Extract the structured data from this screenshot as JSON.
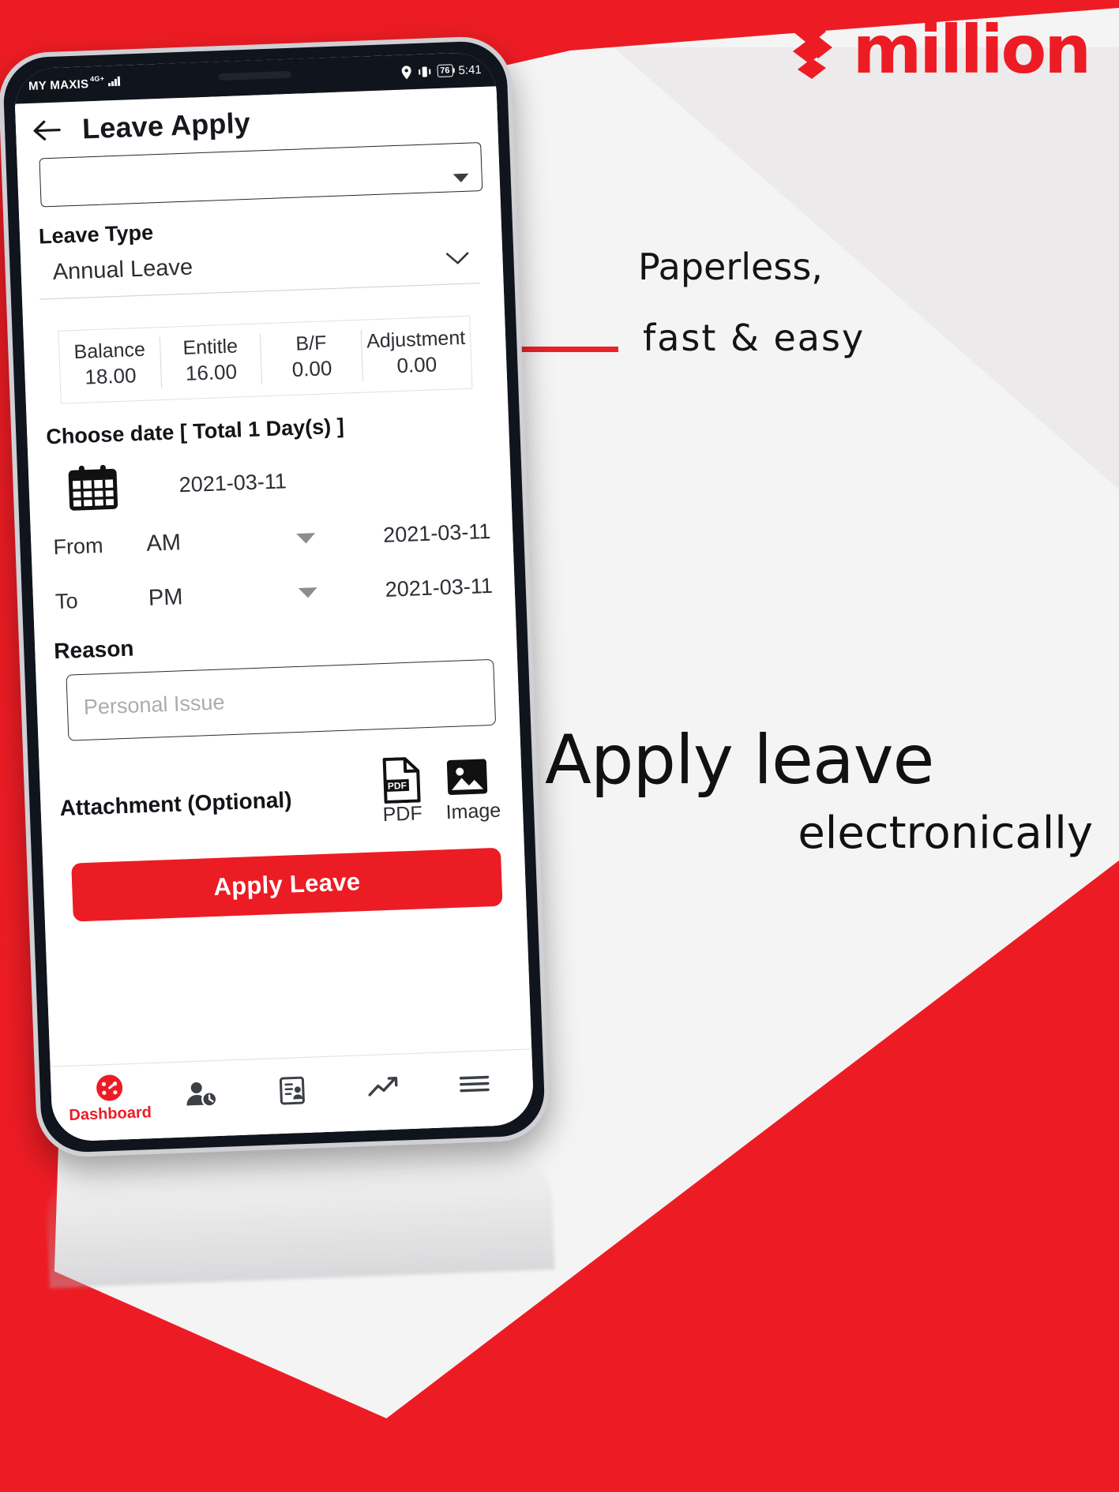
{
  "brand": {
    "logo_word": "million",
    "logo_mark": "million-logo-mark",
    "accent_color": "#ed1c24"
  },
  "marketing": {
    "tagline_line1": "Paperless,",
    "tagline_line2": "fast  &  easy",
    "headline": "Apply leave",
    "subhead": "electronically"
  },
  "phone": {
    "statusbar": {
      "carrier": "MY MAXIS",
      "network": "4G+",
      "signal_icon": "signal-bars-icon",
      "location_icon": "location-pin-icon",
      "vibrate_icon": "vibrate-icon",
      "battery_level": "76",
      "time": "5:41"
    },
    "appbar": {
      "back_icon": "back-arrow-icon",
      "title": "Leave Apply"
    },
    "form": {
      "top_field_caret": "dropdown-caret-icon",
      "leave_type_label": "Leave Type",
      "leave_type_value": "Annual Leave",
      "leave_type_caret": "chevron-down-icon",
      "balance_cells": [
        {
          "key": "Balance",
          "value": "18.00"
        },
        {
          "key": "Entitle",
          "value": "16.00"
        },
        {
          "key": "B/F",
          "value": "0.00"
        },
        {
          "key": "Adjustment",
          "value": "0.00"
        }
      ],
      "choose_date_label": "Choose date [ Total 1 Day(s) ]",
      "calendar_icon": "calendar-icon",
      "chosen_date": "2021-03-11",
      "from": {
        "label": "From",
        "period": "AM",
        "caret": "dropdown-caret-icon",
        "date": "2021-03-11"
      },
      "to": {
        "label": "To",
        "period": "PM",
        "caret": "dropdown-caret-icon",
        "date": "2021-03-11"
      },
      "reason_label": "Reason",
      "reason_placeholder": "Personal Issue",
      "reason_value": "",
      "attachment_label": "Attachment (Optional)",
      "attachment_buttons": [
        {
          "icon": "pdf-file-icon",
          "label": "PDF"
        },
        {
          "icon": "image-file-icon",
          "label": "Image"
        }
      ],
      "submit_label": "Apply Leave"
    },
    "bottom_nav": [
      {
        "icon": "dashboard-gauge-icon",
        "label": "Dashboard"
      },
      {
        "icon": "user-clock-icon",
        "label": ""
      },
      {
        "icon": "document-user-icon",
        "label": ""
      },
      {
        "icon": "chart-line-icon",
        "label": ""
      },
      {
        "icon": "menu-hamburger-icon",
        "label": ""
      }
    ]
  }
}
